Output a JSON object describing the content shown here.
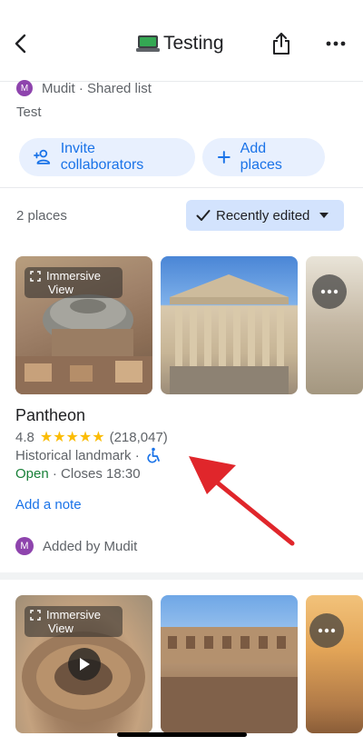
{
  "header": {
    "title": "Testing"
  },
  "list": {
    "owner_initial": "M",
    "owner_text": "Mudit · Shared list",
    "description": "Test",
    "invite_label": "Invite collaborators",
    "add_places_label": "Add places",
    "places_count": "2 places",
    "sort_label": "Recently edited"
  },
  "places": [
    {
      "immersive_line1": "Immersive",
      "immersive_line2": "View",
      "name": "Pantheon",
      "rating": "4.8",
      "stars": "★★★★★",
      "review_count": "(218,047)",
      "category": "Historical landmark ·",
      "status": "Open",
      "hours": "· Closes 18:30",
      "add_note": "Add a note",
      "added_by_initial": "M",
      "added_by": "Added by Mudit"
    },
    {
      "immersive_line1": "Immersive",
      "immersive_line2": "View"
    }
  ],
  "colors": {
    "accent": "#1a73e8",
    "chip_bg": "#e8f0fe",
    "sort_bg": "#d3e3fd",
    "open_green": "#188038",
    "star_yellow": "#fbbc04",
    "avatar_purple": "#8e44ad",
    "annotation_red": "#e0262b"
  },
  "icons": [
    "back-arrow-icon",
    "laptop-emoji-icon",
    "share-icon",
    "more-horizontal-icon",
    "add-person-icon",
    "plus-icon",
    "checkmark-icon",
    "dropdown-triangle-icon",
    "immersive-view-icon",
    "wheelchair-icon",
    "play-icon"
  ]
}
